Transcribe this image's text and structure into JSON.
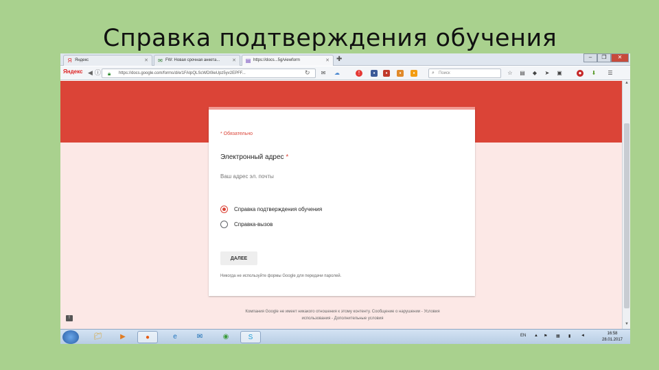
{
  "slide": {
    "title": "Справка подтверждения обучения"
  },
  "browser": {
    "tabs": [
      {
        "label": "Яндекс",
        "favicon": "Я"
      },
      {
        "label": "FW: Новая срочная анкета...",
        "favicon": "✉"
      },
      {
        "label": "https://docs...5g/viewform",
        "favicon": "▤"
      }
    ],
    "brand": "Яндекс",
    "url": "https://docs.google.com/forms/d/e/1FAIpQLScWDl0ieUpz5yv2EPFF...",
    "search_placeholder": "Поиск"
  },
  "form": {
    "required_note": "* Обязательно",
    "question_title": "Электронный адрес",
    "required_star": "*",
    "email_placeholder": "Ваш адрес эл. почты",
    "options": [
      {
        "label": "Справка подтверждения обучения",
        "selected": true
      },
      {
        "label": "Справка-вызов",
        "selected": false
      }
    ],
    "next_button": "ДАЛЕЕ",
    "password_note": "Никогда не используйте формы Google для передачи паролей.",
    "footer_line1": "Компания Google не имеет никакого отношения к этому контенту. Сообщение о нарушении - Условия",
    "footer_line2": "использования - Дополнительные условия"
  },
  "taskbar": {
    "lang": "EN",
    "time": "16:58",
    "date": "28.01.2017"
  },
  "colors": {
    "slide_bg": "#a9d18e",
    "accent_red": "#db4437",
    "page_bg": "#fce8e6"
  }
}
